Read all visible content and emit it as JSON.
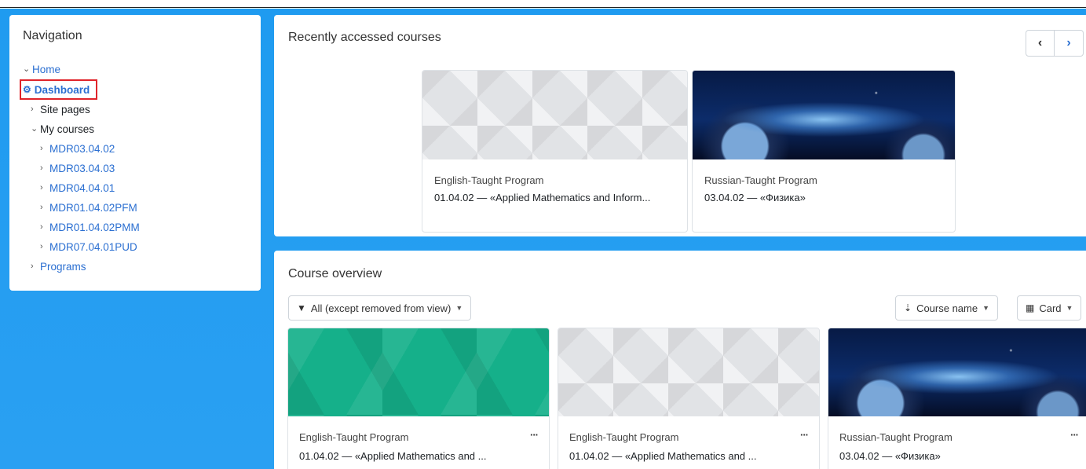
{
  "navigation": {
    "title": "Navigation",
    "home": "Home",
    "dashboard": "Dashboard",
    "site_pages": "Site pages",
    "my_courses": "My courses",
    "courses": [
      "MDR03.04.02",
      "MDR03.04.03",
      "MDR04.04.01",
      "MDR01.04.02PFM",
      "MDR01.04.02PMM",
      "MDR07.04.01PUD"
    ],
    "programs": "Programs"
  },
  "recent": {
    "title": "Recently accessed courses",
    "cards": [
      {
        "category": "English-Taught Program",
        "name": "01.04.02 — «Applied Mathematics and Inform..."
      },
      {
        "category": "Russian-Taught Program",
        "name": "03.04.02 — «Физика»"
      }
    ]
  },
  "overview": {
    "title": "Course overview",
    "filter_label": "All (except removed from view)",
    "sort_label": "Course name",
    "view_label": "Card",
    "cards": [
      {
        "category": "English-Taught Program",
        "name": "01.04.02 — «Applied Mathematics and ..."
      },
      {
        "category": "English-Taught Program",
        "name": "01.04.02 — «Applied Mathematics and ..."
      },
      {
        "category": "Russian-Taught Program",
        "name": "03.04.02 — «Физика»"
      }
    ]
  },
  "icons": {
    "chevron_down": "chevron-down-icon",
    "chevron_right": "chevron-right-icon",
    "dashboard": "dashboard-icon",
    "filter": "filter-icon",
    "sort": "sort-icon",
    "grid": "grid-icon"
  },
  "colors": {
    "background": "#1f9bf0",
    "link": "#2b6fd1",
    "highlight_border": "#e0242a",
    "green_course": "#15b08a"
  }
}
